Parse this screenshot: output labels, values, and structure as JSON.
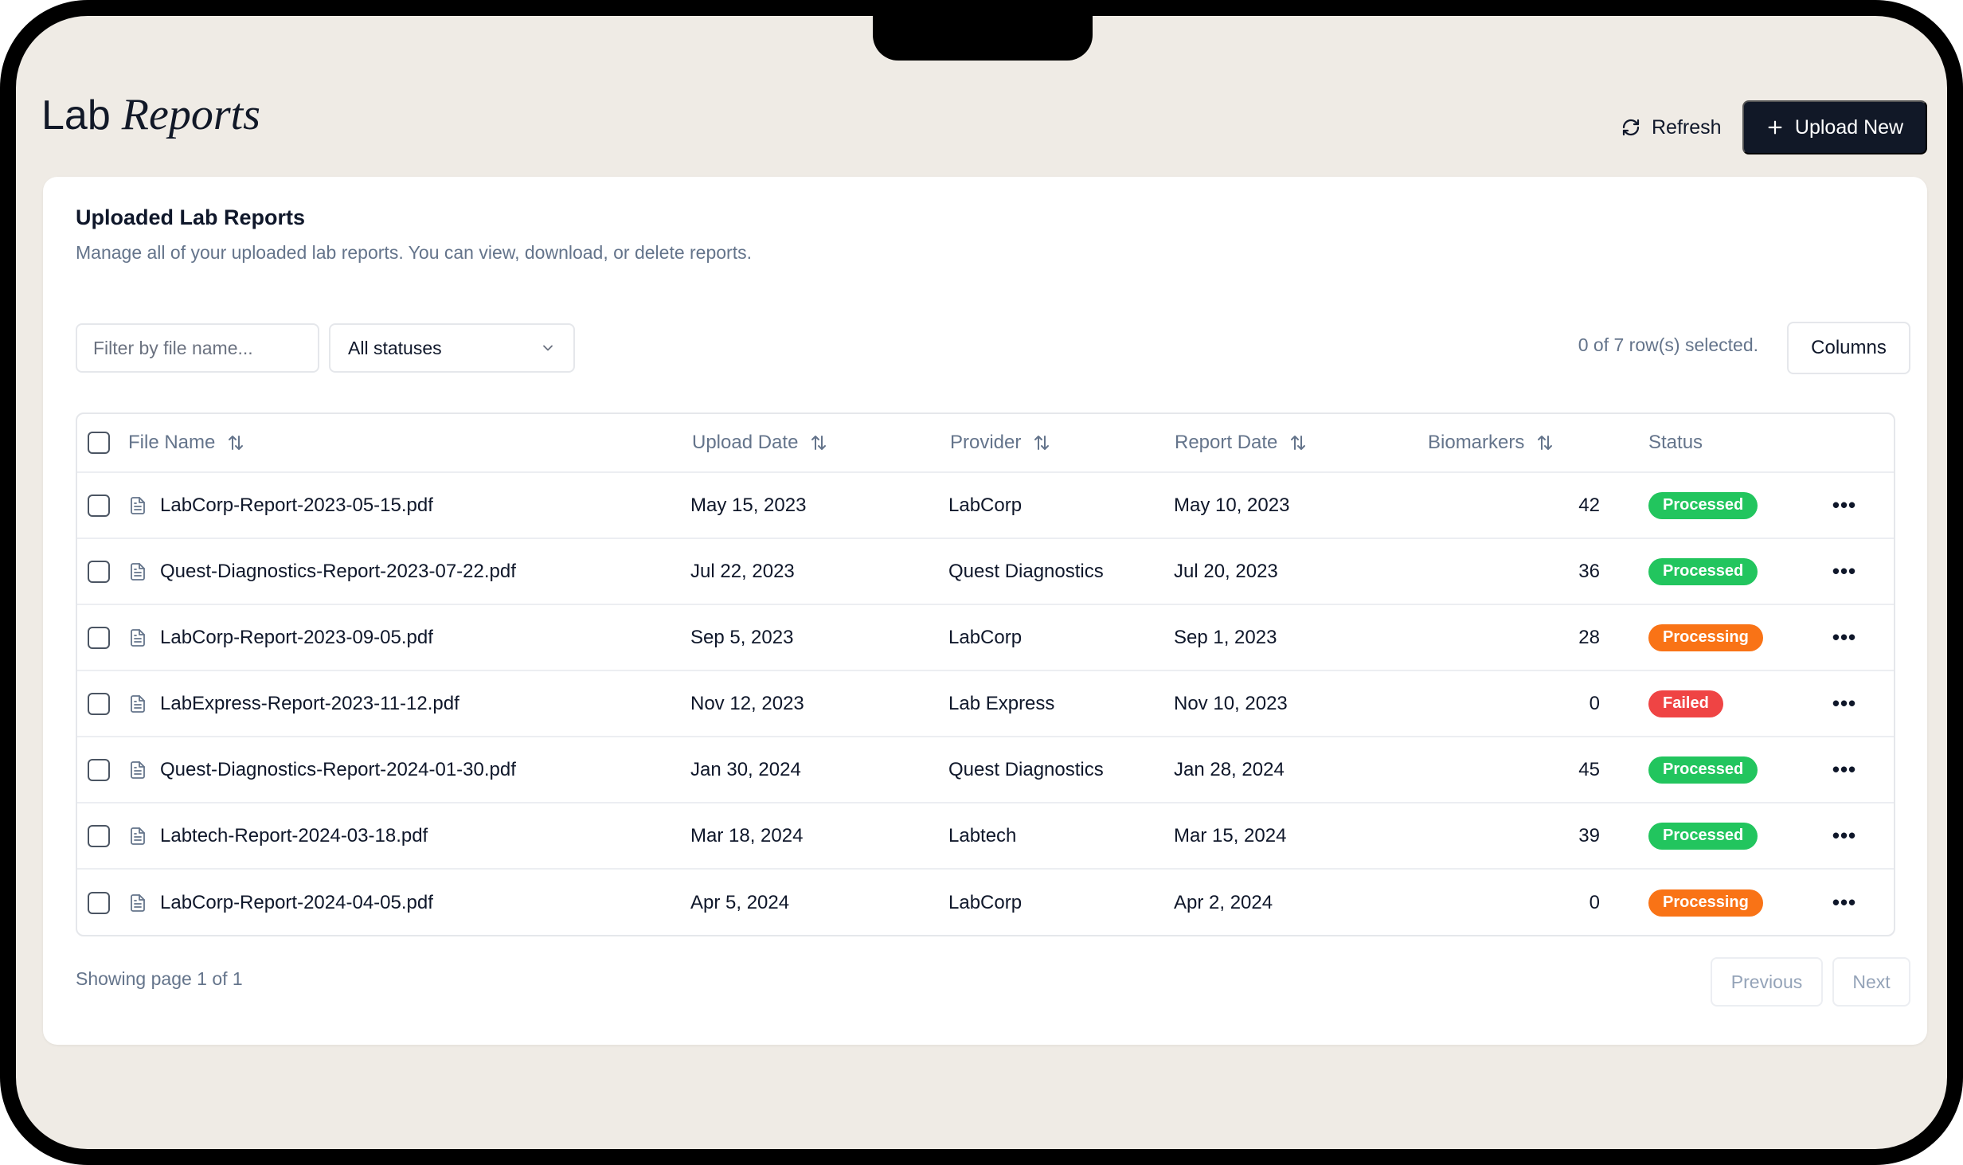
{
  "header": {
    "title_part1": "Lab",
    "title_part2": "Reports",
    "refresh_label": "Refresh",
    "upload_label": "Upload New"
  },
  "card": {
    "title": "Uploaded Lab Reports",
    "subtitle": "Manage all of your uploaded lab reports. You can view, download, or delete reports."
  },
  "filters": {
    "file_placeholder": "Filter by file name...",
    "status_value": "All statuses",
    "selection_text": "0 of 7 row(s) selected.",
    "columns_label": "Columns"
  },
  "table": {
    "headers": {
      "file_name": "File Name",
      "upload_date": "Upload Date",
      "provider": "Provider",
      "report_date": "Report Date",
      "biomarkers": "Biomarkers",
      "status": "Status"
    },
    "rows": [
      {
        "file": "LabCorp-Report-2023-05-15.pdf",
        "upload": "May 15, 2023",
        "provider": "LabCorp",
        "report": "May 10, 2023",
        "biomarkers": "42",
        "status": "Processed",
        "status_color": "#22c55e"
      },
      {
        "file": "Quest-Diagnostics-Report-2023-07-22.pdf",
        "upload": "Jul 22, 2023",
        "provider": "Quest Diagnostics",
        "report": "Jul 20, 2023",
        "biomarkers": "36",
        "status": "Processed",
        "status_color": "#22c55e"
      },
      {
        "file": "LabCorp-Report-2023-09-05.pdf",
        "upload": "Sep 5, 2023",
        "provider": "LabCorp",
        "report": "Sep 1, 2023",
        "biomarkers": "28",
        "status": "Processing",
        "status_color": "#f97316"
      },
      {
        "file": "LabExpress-Report-2023-11-12.pdf",
        "upload": "Nov 12, 2023",
        "provider": "Lab Express",
        "report": "Nov 10, 2023",
        "biomarkers": "0",
        "status": "Failed",
        "status_color": "#ef4444"
      },
      {
        "file": "Quest-Diagnostics-Report-2024-01-30.pdf",
        "upload": "Jan 30, 2024",
        "provider": "Quest Diagnostics",
        "report": "Jan 28, 2024",
        "biomarkers": "45",
        "status": "Processed",
        "status_color": "#22c55e"
      },
      {
        "file": "Labtech-Report-2024-03-18.pdf",
        "upload": "Mar 18, 2024",
        "provider": "Labtech",
        "report": "Mar 15, 2024",
        "biomarkers": "39",
        "status": "Processed",
        "status_color": "#22c55e"
      },
      {
        "file": "LabCorp-Report-2024-04-05.pdf",
        "upload": "Apr 5, 2024",
        "provider": "LabCorp",
        "report": "Apr 2, 2024",
        "biomarkers": "0",
        "status": "Processing",
        "status_color": "#f97316"
      }
    ],
    "row_action_icon": "more-horizontal-icon"
  },
  "footer": {
    "page_text": "Showing page 1 of 1",
    "prev_label": "Previous",
    "next_label": "Next"
  },
  "colors": {
    "background": "#efebe5",
    "primary_button": "#111827",
    "processed": "#22c55e",
    "processing": "#f97316",
    "failed": "#ef4444"
  }
}
